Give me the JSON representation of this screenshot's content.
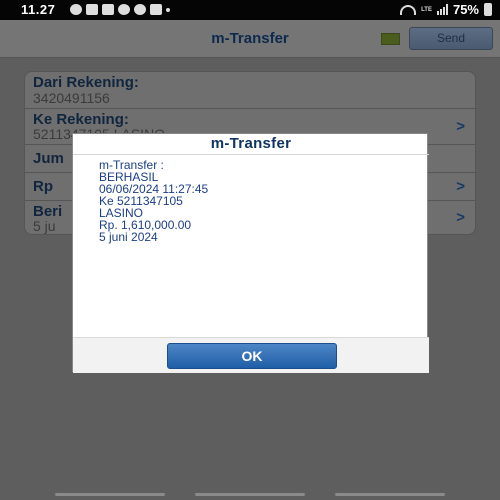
{
  "status_bar": {
    "time": "11.27",
    "battery": "75%",
    "network": "LTE"
  },
  "header": {
    "title": "m-Transfer",
    "send_label": "Send"
  },
  "form": {
    "rows": [
      {
        "label": "Dari Rekening:",
        "value": "3420491156"
      },
      {
        "label": "Ke Rekening:",
        "value": "5211347105  LASINO"
      },
      {
        "label": "Jum",
        "value": ""
      },
      {
        "label": "Rp",
        "value": ""
      },
      {
        "label": "Beri",
        "value": "5 ju"
      }
    ]
  },
  "dialog": {
    "title": "m-Transfer",
    "lines": [
      "m-Transfer :",
      "BERHASIL",
      "06/06/2024 11:27:45",
      "Ke 5211347105",
      "LASINO",
      "Rp. 1,610,000.00",
      "5 juni 2024"
    ],
    "ok_label": "OK"
  },
  "colors": {
    "accent": "#1f5ea6",
    "dialog_text": "#1b3f86",
    "title_text": "#0f3464"
  },
  "icons": [
    "whatsapp-icon",
    "bag-icon",
    "bag-icon",
    "chrome-icon",
    "chat-icon",
    "gmail-icon",
    "dot-icon",
    "wifi-icon",
    "signal-icon",
    "battery-icon"
  ]
}
